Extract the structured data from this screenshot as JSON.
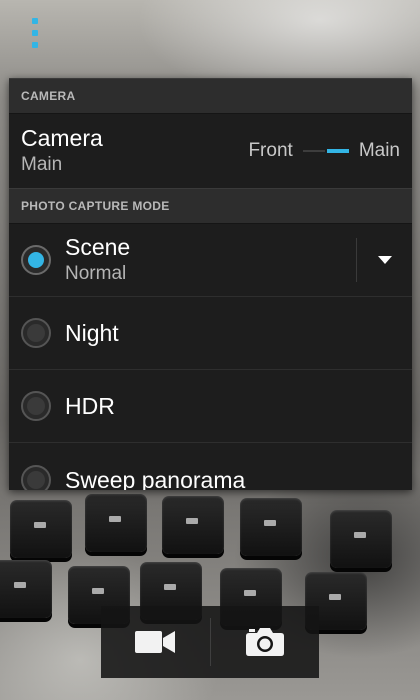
{
  "overflow_menu": {
    "icon": "overflow-menu-icon",
    "color": "#33b5e5"
  },
  "camera_section": {
    "header": "CAMERA",
    "title": "Camera",
    "value": "Main",
    "switch": {
      "left_label": "Front",
      "right_label": "Main",
      "selected": "Main"
    }
  },
  "photo_capture": {
    "header": "PHOTO CAPTURE MODE",
    "modes": [
      {
        "label": "Scene",
        "sub": "Normal",
        "selected": true
      },
      {
        "label": "Night",
        "selected": false
      },
      {
        "label": "HDR",
        "selected": false
      },
      {
        "label": "Sweep panorama",
        "selected": false
      }
    ]
  },
  "bottom_bar": {
    "video_icon": "video-camera-icon",
    "photo_icon": "camera-icon"
  },
  "colors": {
    "accent": "#33b5e5",
    "panel": "#1d1d1d",
    "header": "#2d2d2d"
  }
}
